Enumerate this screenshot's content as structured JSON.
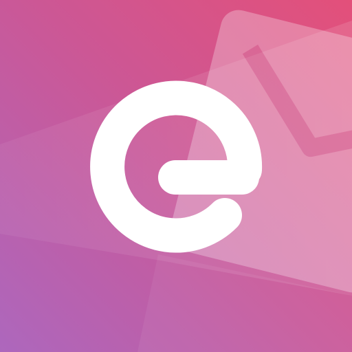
{
  "app_icon": {
    "glyph": "e",
    "colors": {
      "gradient_top_right": "#e04f7d",
      "gradient_mid": "#cc5795",
      "gradient_bottom_left": "#b066b8",
      "envelope_overlay": "#ffffff",
      "letter": "#ffffff"
    },
    "icons": [
      "letter-e-logo",
      "envelope-icon"
    ]
  }
}
